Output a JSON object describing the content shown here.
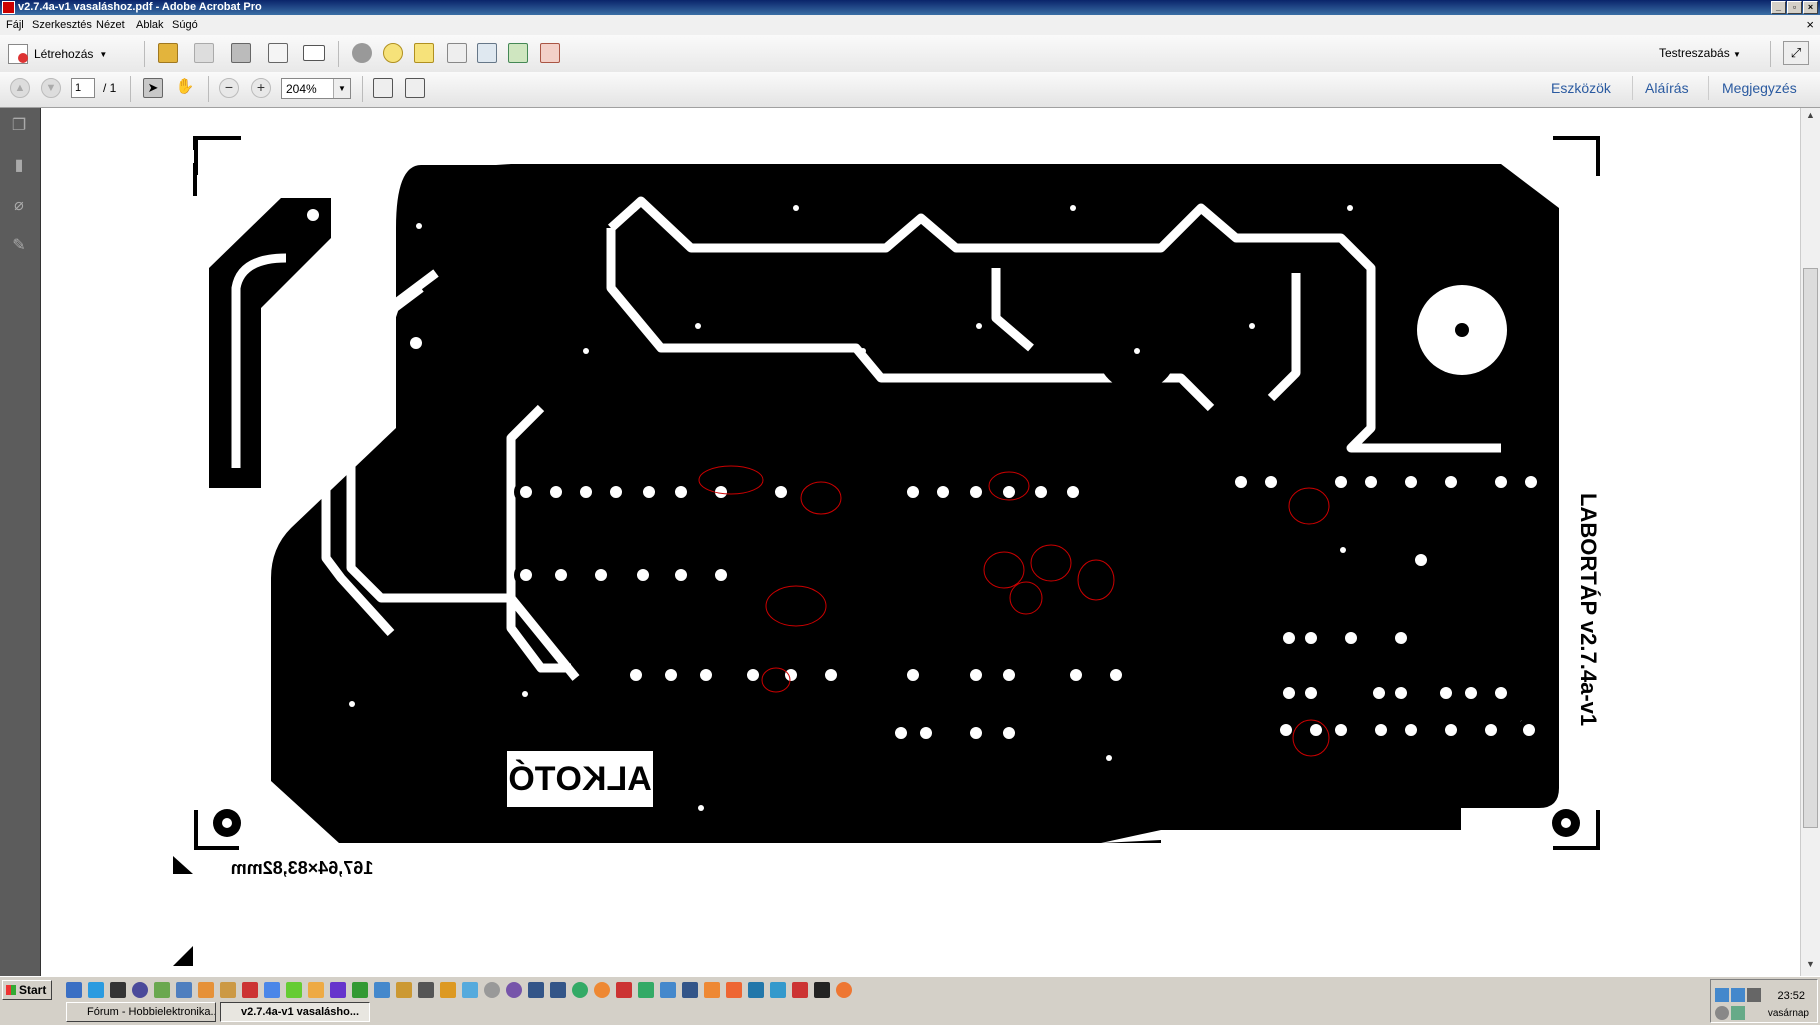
{
  "window": {
    "title": "v2.7.4a-v1 vasaláshoz.pdf - Adobe Acrobat Pro",
    "doc_close": "×"
  },
  "menu": [
    "Fájl",
    "Szerkesztés",
    "Nézet",
    "Ablak",
    "Súgó"
  ],
  "toolbar": {
    "create_label": "Létrehozás",
    "customize_label": "Testreszabás",
    "icons": [
      "open-folder-icon",
      "save-icon",
      "print-icon",
      "edit-icon",
      "email-icon",
      "settings-icon",
      "comment-icon",
      "stamp-icon",
      "document-icon",
      "scan-icon",
      "export-icon",
      "review-icon"
    ]
  },
  "nav": {
    "page_current": "1",
    "page_total": "/ 1",
    "zoom": "204%"
  },
  "tabs": [
    "Eszközök",
    "Aláírás",
    "Megjegyzés"
  ],
  "pcb": {
    "logo_text": "ALKOTÓ",
    "dimension_text": "167,64×83,82mm",
    "side_text": "LABORTÁP v2.7.4a-v1"
  },
  "taskbar": {
    "start_label": "Start",
    "windows": [
      {
        "label": "Fórum - Hobbielektronika...",
        "active": false
      },
      {
        "label": "v2.7.4a-v1 vasalásho...",
        "active": true
      }
    ],
    "clock": "23:52",
    "day": "vasárnap"
  }
}
